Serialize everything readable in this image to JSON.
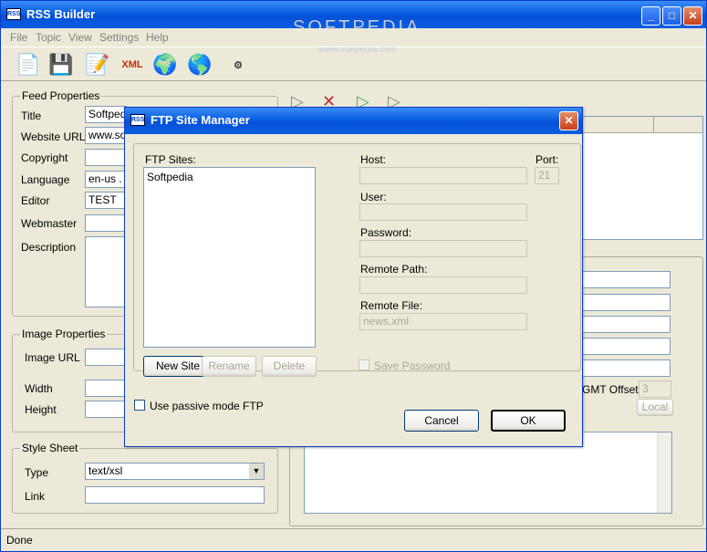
{
  "app": {
    "title": "RSS Builder",
    "icon_text": "RSS"
  },
  "watermark": {
    "main": "SOFTPEDIA",
    "sub": "www.softpedia.com"
  },
  "menu": [
    "File",
    "Topic",
    "View",
    "Settings",
    "Help"
  ],
  "feed_properties": {
    "title": "Feed Properties",
    "labels": {
      "title": "Title",
      "website_url": "Website URL",
      "copyright": "Copyright",
      "language": "Language",
      "editor": "Editor",
      "webmaster": "Webmaster",
      "description": "Description"
    },
    "values": {
      "title": "Softpedia",
      "website_url": "www.sof",
      "copyright": "",
      "language": "en-us . E",
      "editor": "TEST",
      "webmaster": ""
    }
  },
  "image_properties": {
    "title": "Image Properties",
    "labels": {
      "image_url": "Image URL",
      "width": "Width",
      "height": "Height"
    }
  },
  "style_sheet": {
    "title": "Style Sheet",
    "labels": {
      "type": "Type",
      "link": "Link"
    },
    "type_value": "text/xsl"
  },
  "right_panel": {
    "gmt_label": "GMT Offset",
    "gmt_value": "3",
    "local_button": "Local"
  },
  "status": "Done",
  "dialog": {
    "title": "FTP Site Manager",
    "ftp_sites_label": "FTP Sites:",
    "sites": [
      "Softpedia"
    ],
    "host_label": "Host:",
    "port_label": "Port:",
    "port_value": "21",
    "user_label": "User:",
    "password_label": "Password:",
    "remote_path_label": "Remote Path:",
    "remote_file_label": "Remote File:",
    "remote_file_value": "news.xml",
    "new_site": "New Site",
    "rename": "Rename",
    "delete": "Delete",
    "save_password": "Save Password",
    "passive_mode": "Use passive mode FTP",
    "cancel": "Cancel",
    "ok": "OK"
  }
}
